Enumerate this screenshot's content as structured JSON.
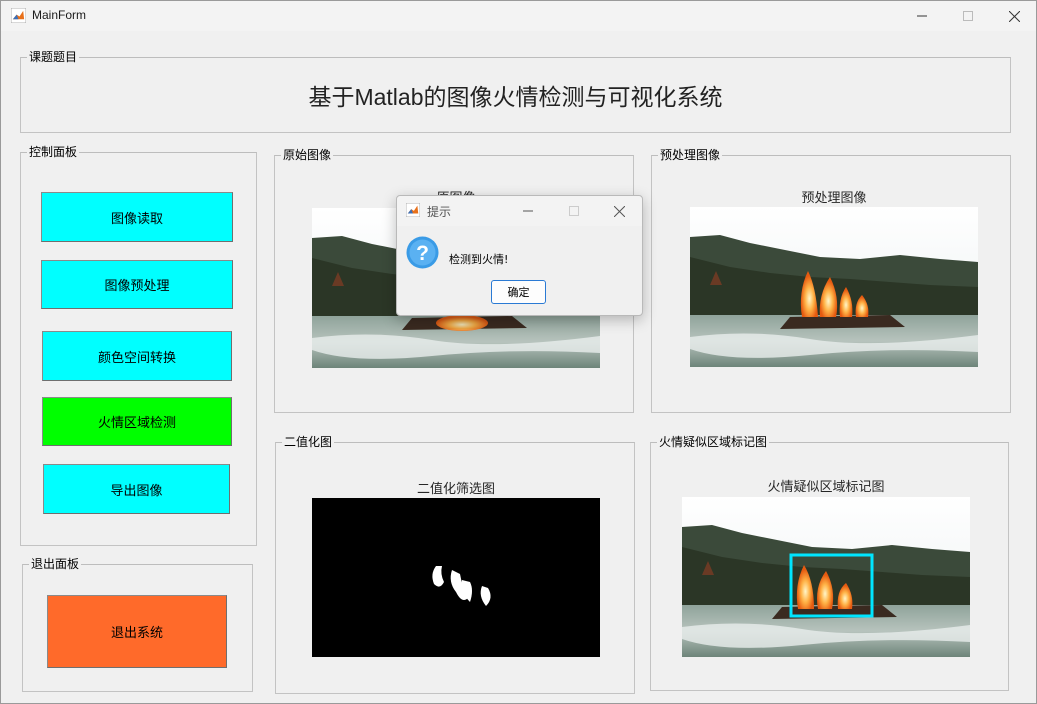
{
  "window": {
    "title": "MainForm"
  },
  "groups": {
    "topic": "课题题目",
    "control": "控制面板",
    "exit": "退出面板",
    "original": "原始图像",
    "preprocessed": "预处理图像",
    "binary": "二值化图",
    "fire_region": "火情疑似区域标记图"
  },
  "main_title": "基于Matlab的图像火情检测与可视化系统",
  "buttons": {
    "read": "图像读取",
    "preprocess": "图像预处理",
    "color_convert": "颜色空间转换",
    "fire_detect": "火情区域检测",
    "export": "导出图像",
    "exit": "退出系统"
  },
  "axes": {
    "original": "原图像",
    "preprocessed": "预处理图像",
    "binary": "二值化筛选图",
    "fire_region": "火情疑似区域标记图"
  },
  "dialog": {
    "title": "提示",
    "message": "检测到火情!",
    "ok": "确定",
    "icon": "question-icon"
  },
  "colors": {
    "cyan_button": "#00ffff",
    "green_button": "#00ff00",
    "exit_button": "#ff6a2a",
    "marker_box": "#00e5ff"
  }
}
